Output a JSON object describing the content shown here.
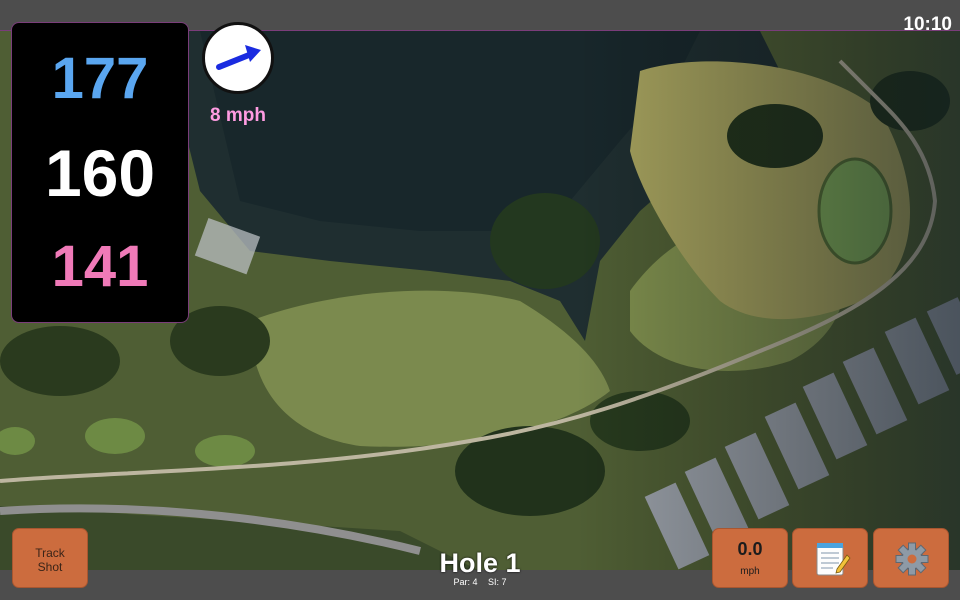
{
  "status_bar": {
    "time": "10:10"
  },
  "yardage": {
    "back": "177",
    "middle": "160",
    "front": "141"
  },
  "wind": {
    "speed": "8 mph",
    "icon": "wind-direction-arrow-icon",
    "arrow_color": "#1a2be0"
  },
  "hole": {
    "title": "Hole 1",
    "par": "Par: 4",
    "stroke_index": "SI: 7"
  },
  "buttons": {
    "track_shot": {
      "line1": "Track",
      "line2": "Shot"
    },
    "speed": {
      "value": "0.0",
      "unit": "mph"
    },
    "notes": {
      "icon": "notepad-icon"
    },
    "settings": {
      "icon": "gear-icon"
    }
  },
  "colors": {
    "back_yardage": "#5aa6f0",
    "middle_yardage": "#ffffff",
    "front_yardage": "#f07ab8",
    "wind_text": "#ff9ce2",
    "button": "#cc6c3e",
    "bars": "#4d4d4d"
  }
}
